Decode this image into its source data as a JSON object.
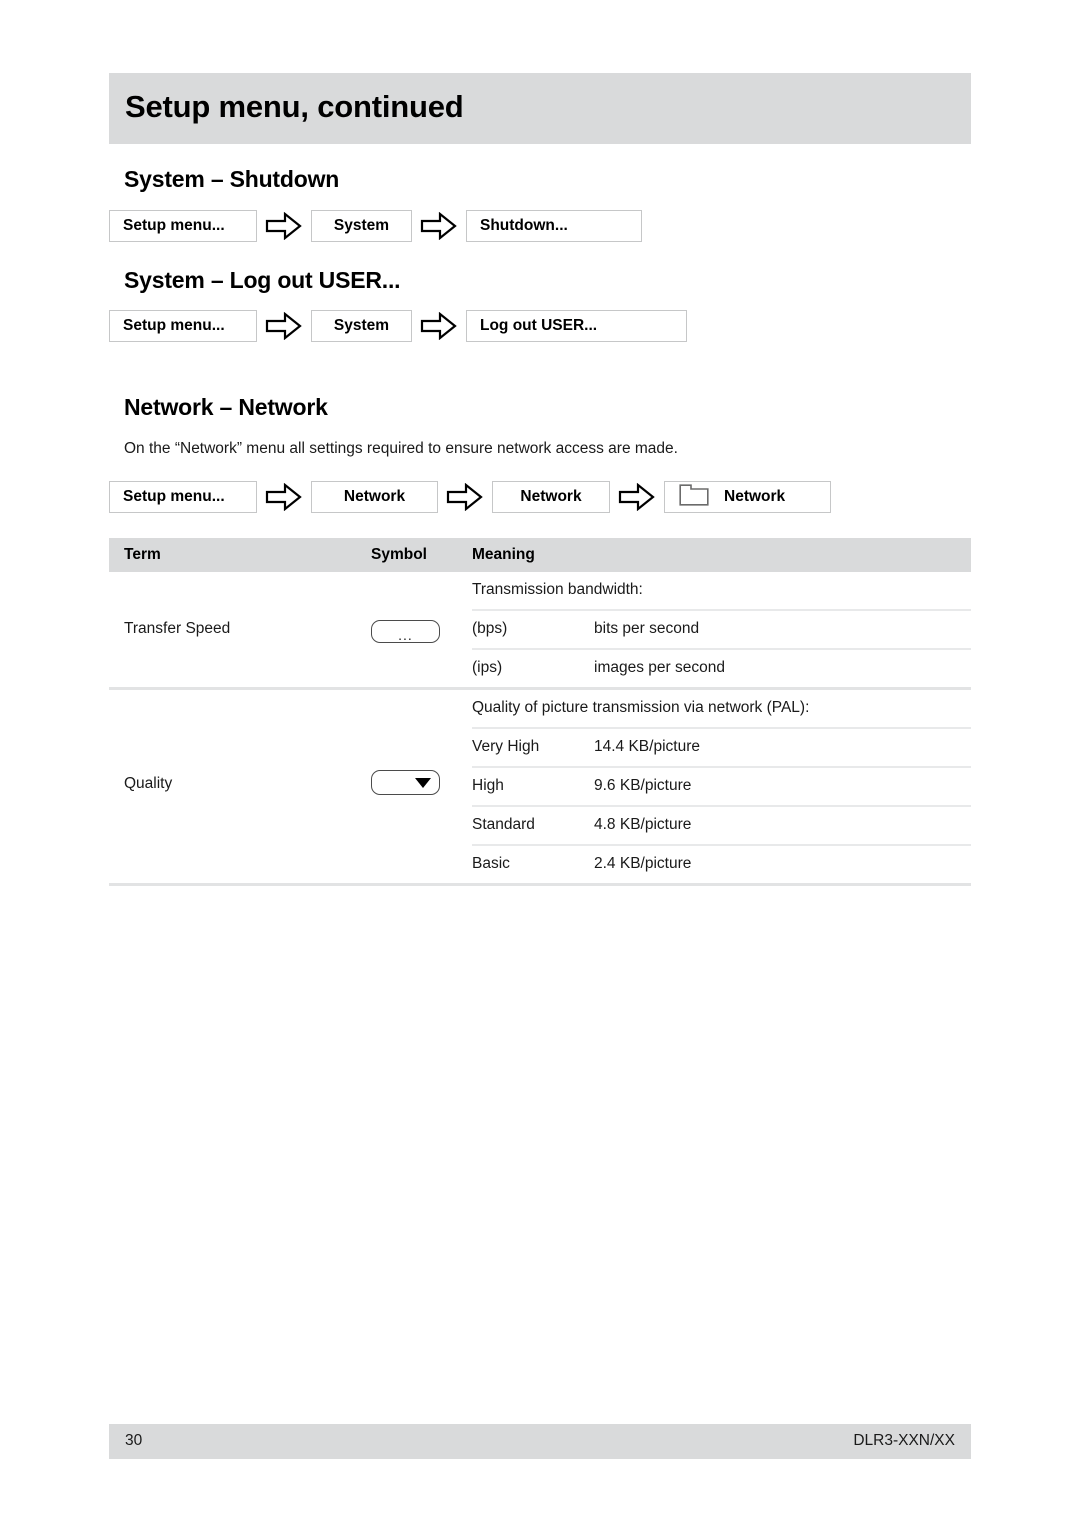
{
  "chapter": {
    "title": "Setup menu, continued"
  },
  "sections": {
    "shutdown": {
      "heading": "System – Shutdown",
      "crumbs": [
        "Setup menu...",
        "System",
        "Shutdown..."
      ]
    },
    "logout": {
      "heading": "System – Log out USER...",
      "crumbs": [
        "Setup menu...",
        "System",
        "Log out USER..."
      ]
    },
    "network": {
      "heading": "Network – Network",
      "intro": "On the “Network” menu all settings required to ensure network access are made.",
      "crumbs": [
        "Setup menu...",
        "Network",
        "Network",
        "Network"
      ],
      "crumb_icon": "folder-icon"
    }
  },
  "table": {
    "headers": {
      "term": "Term",
      "symbol": "Symbol",
      "meaning": "Meaning"
    },
    "groups": [
      {
        "term": "Transfer Speed",
        "symbol_type": "ellipsis-button",
        "symbol_label": "...",
        "rows": [
          {
            "label": "Transmission bandwidth:",
            "value": "",
            "full": true
          },
          {
            "label": "(bps)",
            "value": "bits per second",
            "full": false
          },
          {
            "label": "(ips)",
            "value": "images per second",
            "full": false
          }
        ]
      },
      {
        "term": "Quality",
        "symbol_type": "dropdown",
        "symbol_label": "",
        "rows": [
          {
            "label": "Quality of picture transmission via network (PAL):",
            "value": "",
            "full": true
          },
          {
            "label": "Very High",
            "value": "14.4 KB/picture",
            "full": false
          },
          {
            "label": "High",
            "value": "9.6 KB/picture",
            "full": false
          },
          {
            "label": "Standard",
            "value": "4.8 KB/picture",
            "full": false
          },
          {
            "label": "Basic",
            "value": "2.4 KB/picture",
            "full": false
          }
        ]
      }
    ]
  },
  "footer": {
    "page_number": "30",
    "model": "DLR3-XXN/XX"
  },
  "colors": {
    "band_gray": "#d9dadb",
    "rule_gray": "#e2e3e4",
    "box_border": "#c6c7c8",
    "text": "#1a1a1a"
  }
}
